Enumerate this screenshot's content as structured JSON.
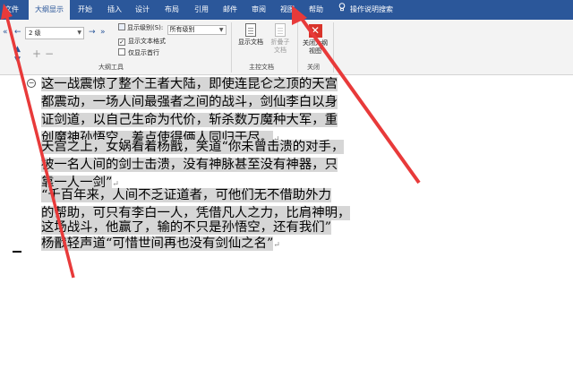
{
  "tabs": [
    {
      "label": "文件",
      "active": false
    },
    {
      "label": "大纲显示",
      "active": true
    },
    {
      "label": "开始",
      "active": false
    },
    {
      "label": "插入",
      "active": false
    },
    {
      "label": "设计",
      "active": false
    },
    {
      "label": "布局",
      "active": false
    },
    {
      "label": "引用",
      "active": false
    },
    {
      "label": "邮件",
      "active": false
    },
    {
      "label": "审阅",
      "active": false
    },
    {
      "label": "视图",
      "active": false
    },
    {
      "label": "帮助",
      "active": false
    }
  ],
  "tell_me": "操作说明搜索",
  "ribbon": {
    "outline_tools": {
      "level_value": "2 级",
      "show_level_label": "显示级别(S):",
      "show_level_value": "所有级别",
      "show_text_format_label": "显示文本格式",
      "show_text_format_checked": true,
      "show_first_line_label": "仅显示首行",
      "show_first_line_checked": false,
      "group_label": "大纲工具"
    },
    "master_document": {
      "show_document_label": "显示文档",
      "collapse_subdocs_label": "折叠子文档",
      "group_label": "主控文档"
    },
    "close": {
      "close_view_label": "关闭大纲视图",
      "group_label": "关闭"
    }
  },
  "document": {
    "lines": [
      "这一战震惊了整个王者大陆，即使连昆仑之顶的天宫",
      "都震动，一场人间最强者之间的战斗，剑仙李白以身",
      "证剑道，以自己生命为代价，斩杀数万魔种大军，重",
      "创魔神孙悟空，差点使得俩人同归于尽。",
      "天宫之上，女娲看着杨戬，笑道“你未曾击溃的对手，",
      "被一名人间的剑士击溃，没有神脉甚至没有神器，只",
      "靠一人一剑”",
      "“千百年来，人间不乏证道者，可他们无不借助外力",
      "的帮助，可只有李白一人，凭借凡人之力，比肩神明，",
      "这场战斗，他赢了，输的不只是孙悟空，还有我们”",
      "杨戬轻声道“可惜世间再也没有剑仙之名”"
    ]
  },
  "colors": {
    "title_bar": "#2b579a",
    "ribbon_bg": "#f3f3f3",
    "highlight": "#d6d6d6",
    "annotation_arrow": "#e83a3a"
  }
}
